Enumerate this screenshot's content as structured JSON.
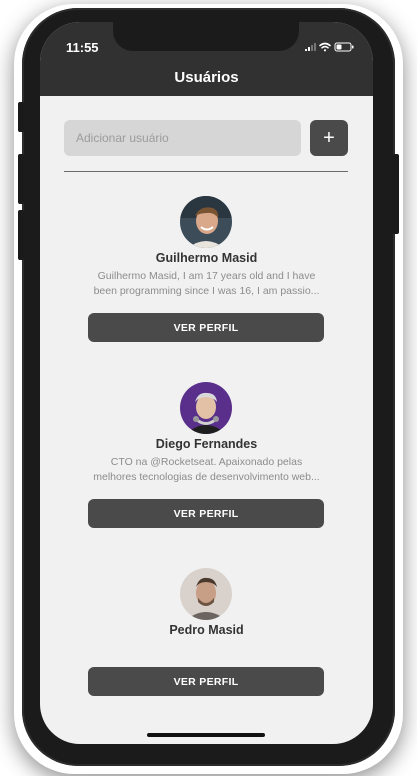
{
  "status_bar": {
    "time": "11:55"
  },
  "header": {
    "title": "Usuários"
  },
  "add_user": {
    "placeholder": "Adicionar usuário",
    "button_label": "+"
  },
  "users": [
    {
      "name": "Guilhermo Masid",
      "bio": "Guilhermo Masid, I am 17 years old and I have been programming since I was 16, I am passio...",
      "button_label": "VER PERFIL"
    },
    {
      "name": "Diego Fernandes",
      "bio": "CTO na @Rocketseat. Apaixonado pelas melhores tecnologias de desenvolvimento web...",
      "button_label": "VER PERFIL"
    },
    {
      "name": "Pedro Masid",
      "bio": "",
      "button_label": "VER PERFIL"
    }
  ],
  "colors": {
    "header_bg": "#313131",
    "screen_bg": "#f1f1f1",
    "button_bg": "#4a4a4a",
    "input_bg": "#d6d6d6"
  }
}
